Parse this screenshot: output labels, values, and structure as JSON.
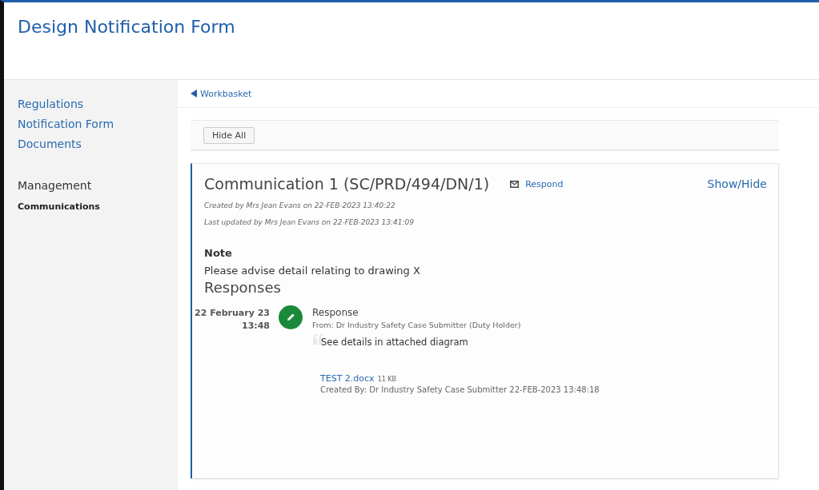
{
  "header": {
    "title": "Design Notification Form"
  },
  "sidebar": {
    "links": [
      {
        "label": "Regulations",
        "selected": false
      },
      {
        "label": "Notification Form",
        "selected": false
      },
      {
        "label": "Documents",
        "selected": false
      }
    ],
    "section": {
      "heading": "Management",
      "items": [
        {
          "label": "Communications",
          "selected": true
        }
      ]
    }
  },
  "breadcrumb": {
    "label": "Workbasket"
  },
  "toolbar": {
    "button": "Hide All"
  },
  "communication": {
    "title": "Communication 1 (SC/PRD/494/DN/1)",
    "respond": "Respond",
    "toggle": "Show/Hide",
    "created": "Created by Mrs Jean Evans on 22-FEB-2023 13:40:22",
    "updated": "Last updated by Mrs Jean Evans on 22-FEB-2023 13:41:09",
    "note_heading": "Note",
    "note": "Please advise detail relating to drawing X",
    "responses_heading": "Responses",
    "responses": [
      {
        "date": "22 February 23",
        "time": "13:48",
        "title": "Response",
        "from": "From: Dr Industry Safety Case Submitter (Duty Holder)",
        "quote": "See details in attached diagram",
        "attachment": {
          "name": "TEST 2.docx",
          "size": "11 KB",
          "created": "Created By: Dr Industry Safety Case Submitter 22-FEB-2023 13:48:18"
        }
      }
    ]
  }
}
